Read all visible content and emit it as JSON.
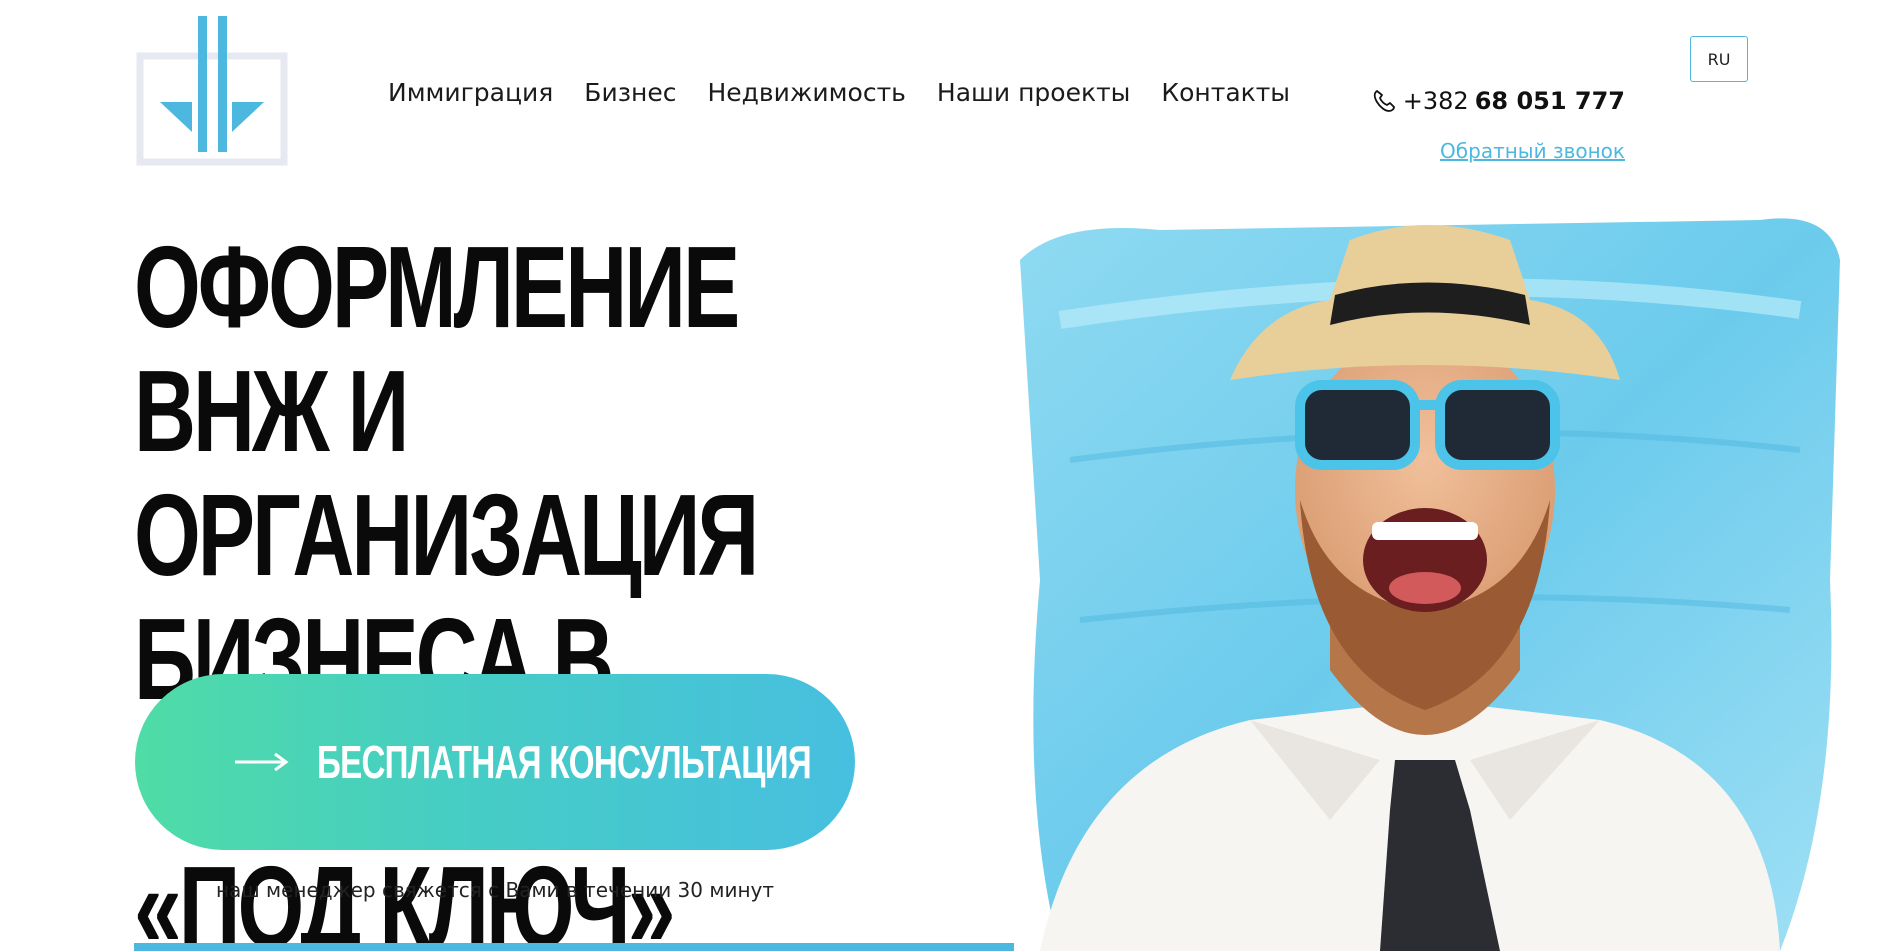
{
  "logo": {
    "icon": "down-arrows-logo",
    "colors": {
      "arrows": "#4cb8e0",
      "frame": "#e6e8f2"
    }
  },
  "nav": {
    "items": [
      {
        "label": "Иммиграция"
      },
      {
        "label": "Бизнес"
      },
      {
        "label": "Недвижимость"
      },
      {
        "label": "Наши проекты"
      },
      {
        "label": "Контакты"
      }
    ]
  },
  "contact": {
    "phone_icon": "phone-icon",
    "phone_prefix": "+382",
    "phone_number": "68 051 777",
    "callback_label": "Обратный звонок"
  },
  "lang": {
    "current": "RU"
  },
  "hero": {
    "title_lines": [
      "ОФОРМЛЕНИЕ ВНЖ И",
      "ОРГАНИЗАЦИЯ БИЗНЕСА В",
      "ЧЕРНОГОРИИ «ПОД КЛЮЧ»"
    ],
    "cta_label": "БЕСПЛАТНАЯ КОНСУЛЬТАЦИЯ",
    "cta_icon": "arrow-right-icon",
    "cta_note": "наш менеджер свяжется с Вами в течении 30 минут",
    "image": "laughing-man-with-hat-sunglasses-and-inflatable-mattress"
  },
  "colors": {
    "accent": "#4cb8e0",
    "gradient_start": "#4fdca6",
    "gradient_end": "#47bfe0",
    "text": "#0a0a0a"
  }
}
